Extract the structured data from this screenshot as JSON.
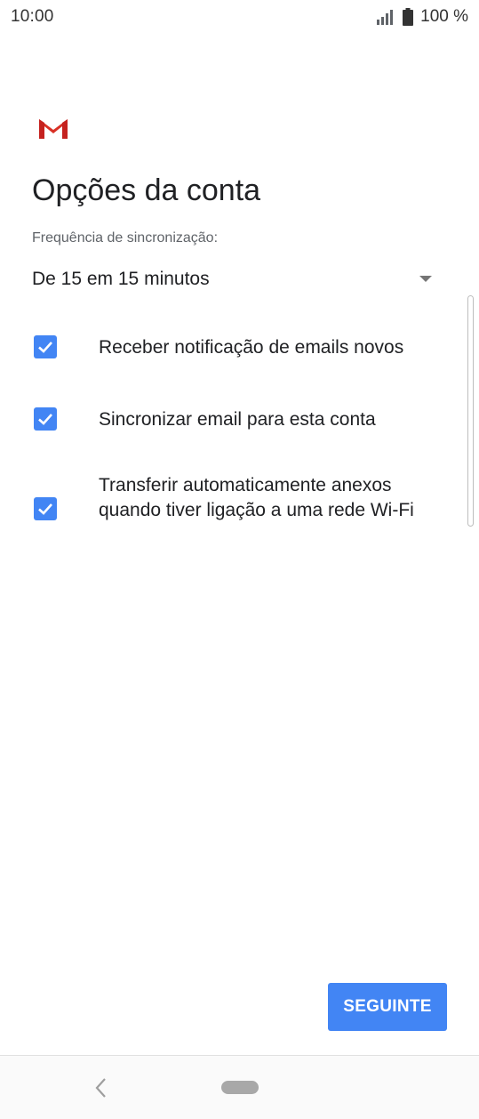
{
  "status_bar": {
    "time": "10:00",
    "battery": "100 %",
    "icons": [
      "signal-icon",
      "battery-icon"
    ]
  },
  "logo": {
    "icon": "gmail-logo-icon"
  },
  "page": {
    "title": "Opções da conta",
    "frequency_label": "Frequência de sincronização:",
    "frequency_value": "De 15 em 15 minutos"
  },
  "options": [
    {
      "label": "Receber notificação de emails novos",
      "checked": true
    },
    {
      "label": "Sincronizar email para esta conta",
      "checked": true
    },
    {
      "label": "Transferir automaticamente anexos quando tiver ligação a uma rede Wi-Fi",
      "checked": true
    }
  ],
  "actions": {
    "next_label": "SEGUINTE"
  },
  "colors": {
    "accent": "#4285f4",
    "gmail_red": "#d93025",
    "text_primary": "#202124",
    "text_secondary": "#5f6368"
  }
}
